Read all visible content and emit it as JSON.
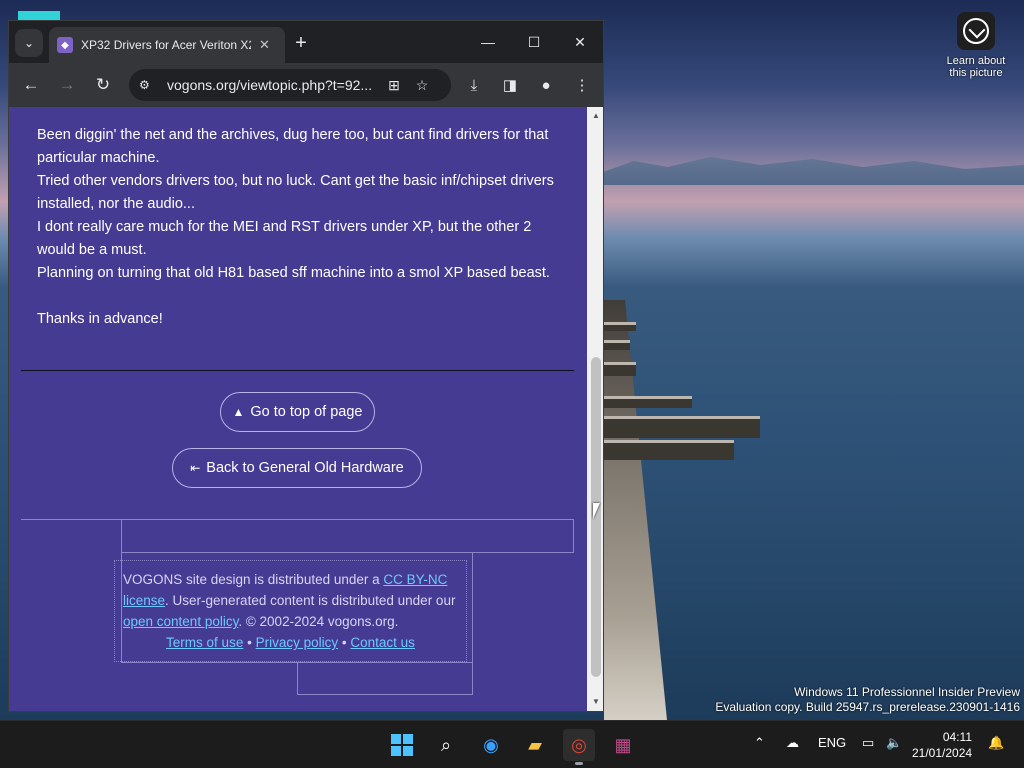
{
  "desktop": {
    "learn_label": "Learn about this picture",
    "watermark_line1": "Windows 11 Professionnel Insider Preview",
    "watermark_line2": "Evaluation copy. Build 25947.rs_prerelease.230901-1416"
  },
  "browser": {
    "tab_title": "XP32 Drivers for Acer Veriton X2",
    "url": "vogons.org/viewtopic.php?t=92...",
    "icons": {
      "tab_search": "chevron-down-icon",
      "new_tab": "plus-icon",
      "back": "arrow-left-icon",
      "forward": "arrow-right-icon",
      "reload": "reload-icon",
      "site_info": "tune-icon",
      "translate": "translate-icon",
      "bookmark": "star-icon",
      "download": "download-icon",
      "side_panel": "side-panel-icon",
      "profile": "person-icon",
      "menu": "kebab-menu-icon"
    }
  },
  "post": {
    "lines": [
      "Been diggin' the net and the archives, dug here too, but cant find drivers for that particular machine.",
      "Tried other vendors drivers too, but no luck. Cant get the basic inf/chipset drivers installed, nor the audio...",
      "I dont really care much for the MEI and RST drivers under XP, but the other 2 would be a must.",
      "Planning on turning that old H81 based sff machine into a smol XP based beast."
    ],
    "thanks": "Thanks in advance!"
  },
  "nav": {
    "top_label": "Go to top of page",
    "back_label": "Back to General Old Hardware"
  },
  "footer": {
    "text1": "VOGONS site design is distributed under a ",
    "license_link": "CC BY-NC license",
    "text2": ". User-generated content is distributed under our ",
    "policy_link": "open content policy",
    "text3": ". © 2002-2024 vogons.org.",
    "terms": "Terms of use",
    "privacy": "Privacy policy",
    "contact": "Contact us",
    "sep": "•"
  },
  "taskbar": {
    "lang": "ENG",
    "time": "04:11",
    "date": "21/01/2024"
  },
  "colors": {
    "page_bg": "#463b93",
    "link": "#6cc8ff",
    "windows_blue": "#4cc2ff"
  }
}
